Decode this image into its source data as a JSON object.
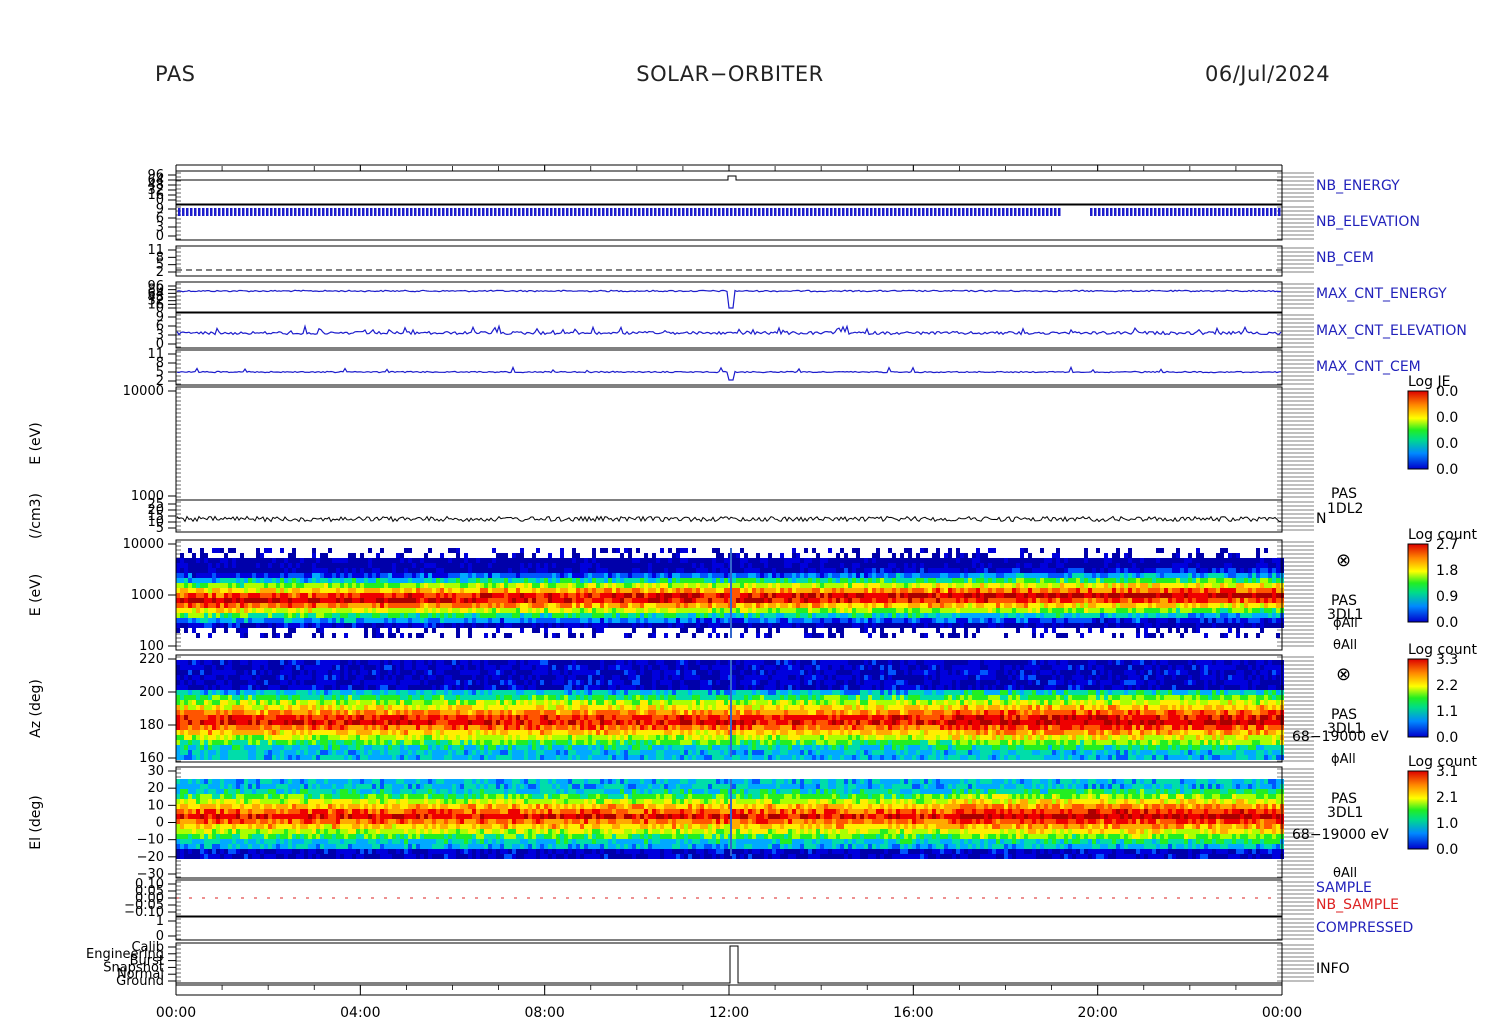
{
  "header": {
    "left": "PAS",
    "center": "SOLAR−ORBITER",
    "right": "06/Jul/2024"
  },
  "colors": {
    "line_blue": "#1c1ccc",
    "label_blue": "#2222bb",
    "label_red": "#dd2222",
    "axis": "#000000"
  },
  "chart_data": {
    "type": "heatmap",
    "x_ticks": [
      "00:00",
      "04:00",
      "08:00",
      "12:00",
      "16:00",
      "20:00",
      "00:00"
    ],
    "x_range_hours": [
      0,
      24
    ],
    "panels": [
      {
        "id": "nb_energy",
        "right_label": "NB_ENERGY",
        "label_color": "blue",
        "type": "line",
        "ylabels": [
          "96",
          "64",
          "48",
          "32",
          "16",
          "0"
        ]
      },
      {
        "id": "nb_elevation",
        "right_label": "NB_ELEVATION",
        "label_color": "blue",
        "type": "line",
        "ylabels": [
          "9",
          "6",
          "3",
          "0"
        ]
      },
      {
        "id": "nb_cem",
        "right_label": "NB_CEM",
        "label_color": "blue",
        "type": "line",
        "ylabels": [
          "11",
          "8",
          "5",
          "2"
        ]
      },
      {
        "id": "max_cnt_energy",
        "right_label": "MAX_CNT_ENERGY",
        "label_color": "blue",
        "type": "line",
        "ylabels": [
          "96",
          "80",
          "64",
          "48",
          "32",
          "16",
          "0"
        ]
      },
      {
        "id": "max_cnt_elevation",
        "right_label": "MAX_CNT_ELEVATION",
        "label_color": "blue",
        "type": "line",
        "ylabels": [
          "9",
          "6",
          "3",
          "0"
        ]
      },
      {
        "id": "max_cnt_cem",
        "right_label": "MAX_CNT_CEM",
        "label_color": "blue",
        "type": "line",
        "ylabels": [
          "11",
          "8",
          "5",
          "2"
        ]
      },
      {
        "id": "je_spectrogram",
        "ylabel": "E (eV)",
        "type": "spectrogram",
        "ylabels": [
          "10000",
          "1000"
        ],
        "colorbar": {
          "title": "Log JE",
          "ticks": [
            "0.0",
            "0.0",
            "0.0",
            "0.0"
          ]
        }
      },
      {
        "id": "density",
        "ylabel": "(/cm3)",
        "right_label": [
          "PAS",
          "1DL2",
          "N"
        ],
        "type": "line",
        "ylabels": [
          "25",
          "20",
          "15",
          "10",
          "5"
        ]
      },
      {
        "id": "energy_spec",
        "ylabel": "E (eV)",
        "right_label": [
          "PAS",
          "3DL1",
          "ϕAll",
          "θAll"
        ],
        "type": "spectrogram",
        "ylabels": [
          "10000",
          "1000",
          "100"
        ],
        "colorbar": {
          "title": "Log count",
          "ticks": [
            "2.7",
            "1.8",
            "0.9",
            "0.0"
          ]
        }
      },
      {
        "id": "azimuth_spec",
        "ylabel": "Az (deg)",
        "right_label": [
          "PAS",
          "3DL1",
          "68−19000 eV",
          "ϕAll"
        ],
        "type": "spectrogram",
        "ylabels": [
          "220",
          "200",
          "180",
          "160"
        ],
        "colorbar": {
          "title": "Log count",
          "ticks": [
            "3.3",
            "2.2",
            "1.1",
            "0.0"
          ]
        }
      },
      {
        "id": "elevation_spec",
        "ylabel": "El (deg)",
        "right_label": [
          "PAS",
          "3DL1",
          "68−19000 eV",
          "θAll"
        ],
        "type": "spectrogram",
        "ylabels": [
          "30",
          "20",
          "10",
          "0",
          "−10",
          "−20",
          "−30"
        ],
        "colorbar": {
          "title": "Log count",
          "ticks": [
            "3.1",
            "2.1",
            "1.0",
            "0.0"
          ]
        }
      },
      {
        "id": "sample",
        "right_label": [
          "SAMPLE",
          "NB_SAMPLE"
        ],
        "type": "line",
        "ylabels": [
          "0.10",
          "0.05",
          "0.00",
          "−0.05",
          "−0.10"
        ]
      },
      {
        "id": "compressed",
        "right_label": "COMPRESSED",
        "label_color": "blue",
        "type": "line",
        "ylabels": [
          "1",
          "0"
        ]
      },
      {
        "id": "info",
        "right_label": "INFO",
        "label_color": "black",
        "type": "step",
        "ylabels": [
          "Calib",
          "Engineering",
          "Burst",
          "Snapshot",
          "Normal",
          "Ground"
        ]
      }
    ]
  }
}
